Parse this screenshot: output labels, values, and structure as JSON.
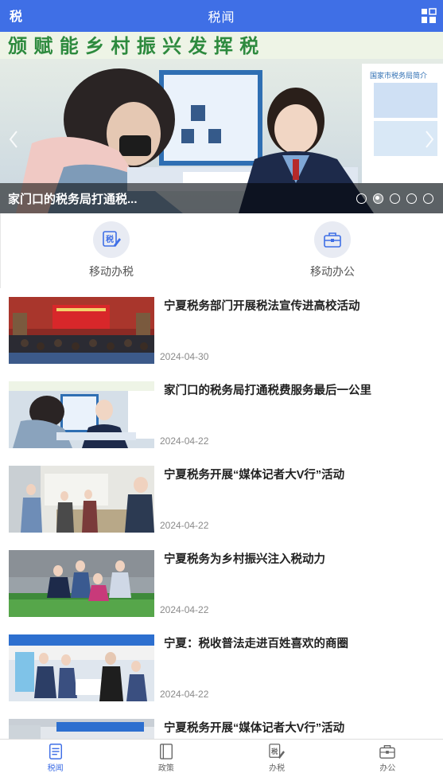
{
  "header": {
    "title": "税闻",
    "logo_text": "税",
    "logo_icon": "tax-logo-icon",
    "menu_icon": "grid-menu-icon"
  },
  "banner": {
    "caption": "家门口的税务局打通税...",
    "slide_count": 5,
    "active_slide": 2,
    "backdrop_text": "颁 赋 能 乡 村 振 兴   发 挥 税",
    "board_text": "国家市税务局简介"
  },
  "quick_actions": [
    {
      "label": "移动办税",
      "icon": "tax-pen-icon"
    },
    {
      "label": "移动办公",
      "icon": "briefcase-icon"
    }
  ],
  "news": [
    {
      "title": "宁夏税务部门开展税法宣传进高校活动",
      "date": "2024-04-30"
    },
    {
      "title": "家门口的税务局打通税费服务最后一公里",
      "date": "2024-04-22"
    },
    {
      "title": "宁夏税务开展“媒体记者大V行”活动",
      "date": "2024-04-22"
    },
    {
      "title": "宁夏税务为乡村振兴注入税动力",
      "date": "2024-04-22"
    },
    {
      "title": "宁夏：税收普法走进百姓喜欢的商圈",
      "date": "2024-04-22"
    },
    {
      "title": "宁夏税务开展“媒体记者大V行”活动",
      "date": ""
    }
  ],
  "tabs": [
    {
      "label": "税闻",
      "icon": "news-doc-icon",
      "active": true
    },
    {
      "label": "政策",
      "icon": "policy-book-icon",
      "active": false
    },
    {
      "label": "办税",
      "icon": "tax-pen-icon",
      "active": false
    },
    {
      "label": "办公",
      "icon": "briefcase-icon",
      "active": false
    }
  ],
  "colors": {
    "primary": "#3f6fe6",
    "text": "#222222",
    "muted": "#8a8a8a"
  }
}
